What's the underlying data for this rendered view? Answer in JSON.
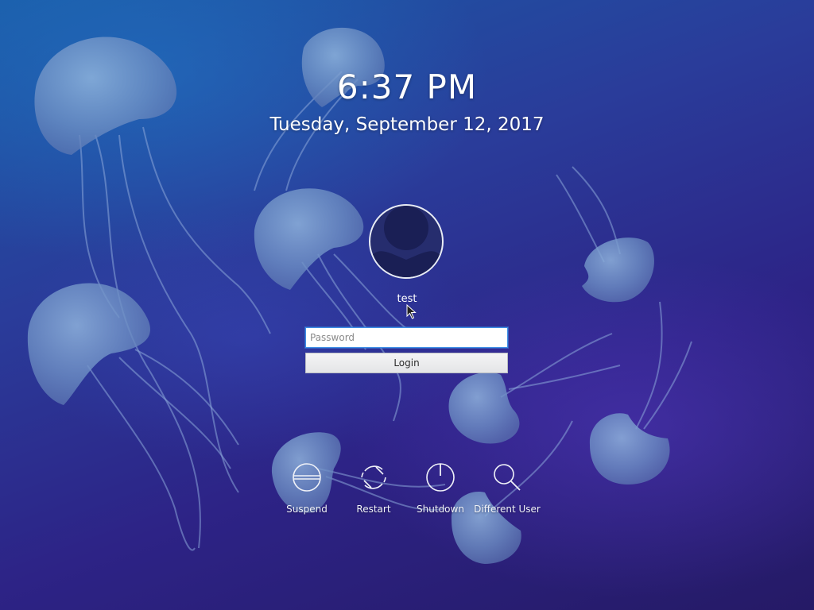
{
  "clock": {
    "time": "6:37 PM",
    "date": "Tuesday, September 12, 2017"
  },
  "user": {
    "name": "test"
  },
  "login": {
    "password_placeholder": "Password",
    "password_value": "",
    "button_label": "Login"
  },
  "actions": [
    {
      "label": "Suspend",
      "icon": "suspend-icon"
    },
    {
      "label": "Restart",
      "icon": "restart-icon"
    },
    {
      "label": "Shutdown",
      "icon": "shutdown-icon"
    },
    {
      "label": "Different User",
      "icon": "search-icon"
    }
  ],
  "colors": {
    "accent": "#3d8ee6",
    "background_top": "#1a5aa6",
    "background_bottom": "#251a66"
  }
}
